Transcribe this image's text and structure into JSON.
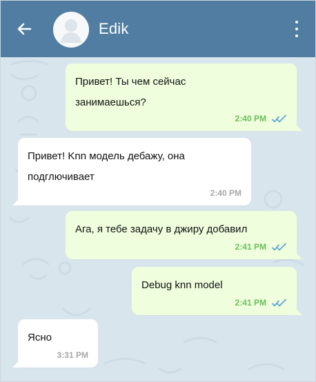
{
  "header": {
    "title": "Edik",
    "back_icon": "arrow-left-icon",
    "avatar_icon": "user-avatar-icon",
    "menu_icon": "more-vertical-icon"
  },
  "colors": {
    "header_bg": "#517da2",
    "chat_bg": "#d9e5ed",
    "outgoing_bg": "#effedd",
    "incoming_bg": "#ffffff",
    "outgoing_time": "#6bbf5a",
    "incoming_time": "#a7a7a7",
    "check": "#5ea6d9"
  },
  "messages": [
    {
      "direction": "out",
      "text": "Привет! Ты чем сейчас\nзанимаешься?",
      "time": "2:40 PM",
      "status_icon": "double-check-icon"
    },
    {
      "direction": "in",
      "text": "Привет! Knn модель дебажу, она\nподглючивает",
      "time": "2:40 PM"
    },
    {
      "direction": "out",
      "text": "Ага, я тебе задачу в джиру добавил",
      "time": "2:41 PM",
      "status_icon": "double-check-icon"
    },
    {
      "direction": "out",
      "text": "Debug knn model",
      "time": "2:41 PM",
      "status_icon": "double-check-icon"
    },
    {
      "direction": "in",
      "text": "Ясно",
      "time": "3:31 PM"
    }
  ]
}
